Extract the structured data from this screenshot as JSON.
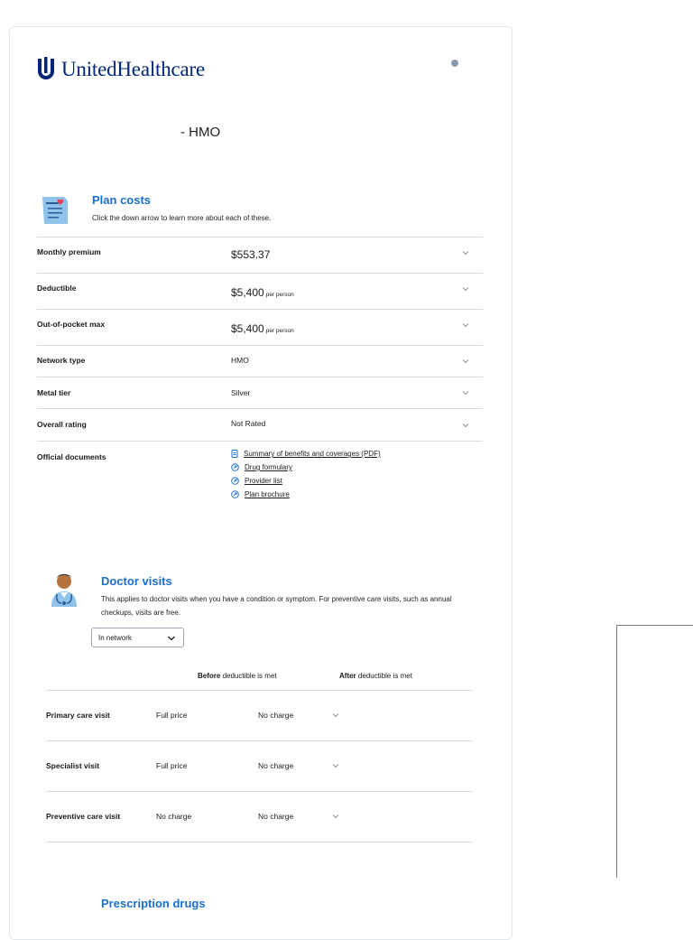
{
  "brand": {
    "name": "UnitedHealthcare",
    "color": "#002677"
  },
  "plan": {
    "name": "- HMO"
  },
  "plan_costs": {
    "title": "Plan costs",
    "subtitle": "Click the down arrow to learn more about each of these.",
    "rows": [
      {
        "label": "Monthly premium",
        "value": "$553.37",
        "unit": ""
      },
      {
        "label": "Deductible",
        "value": "$5,400",
        "unit": "per person"
      },
      {
        "label": "Out-of-pocket max",
        "value": "$5,400",
        "unit": "per person"
      },
      {
        "label": "Network type",
        "value": "HMO",
        "unit": ""
      },
      {
        "label": "Metal tier",
        "value": "Silver",
        "unit": ""
      },
      {
        "label": "Overall rating",
        "value": "Not Rated",
        "unit": ""
      }
    ],
    "docs_label": "Official documents",
    "docs": [
      {
        "label": "Summary of benefits and coverages (PDF)",
        "icon": "pdf-icon"
      },
      {
        "label": "Drug formulary",
        "icon": "external-link-icon"
      },
      {
        "label": "Provider list",
        "icon": "external-link-icon"
      },
      {
        "label": "Plan brochure",
        "icon": "external-link-icon"
      }
    ]
  },
  "doctor_visits": {
    "title": "Doctor visits",
    "subtitle": "This applies to doctor visits when you have a condition or symptom. For preventive care visits, such as annual checkups, visits are free.",
    "network_select": "In network",
    "col_before_bold": "Before",
    "col_before_rest": "deductible is met",
    "col_after_bold": "After",
    "col_after_rest": "deductible is met",
    "rows": [
      {
        "label": "Primary care visit",
        "before": "Full price",
        "after": "No charge"
      },
      {
        "label": "Specialist visit",
        "before": "Full price",
        "after": "No charge"
      },
      {
        "label": "Preventive care visit",
        "before": "No charge",
        "after": "No charge"
      }
    ]
  },
  "prescription": {
    "title": "Prescription drugs"
  },
  "colors": {
    "accent": "#196ecf",
    "divider": "#d5dde4"
  }
}
